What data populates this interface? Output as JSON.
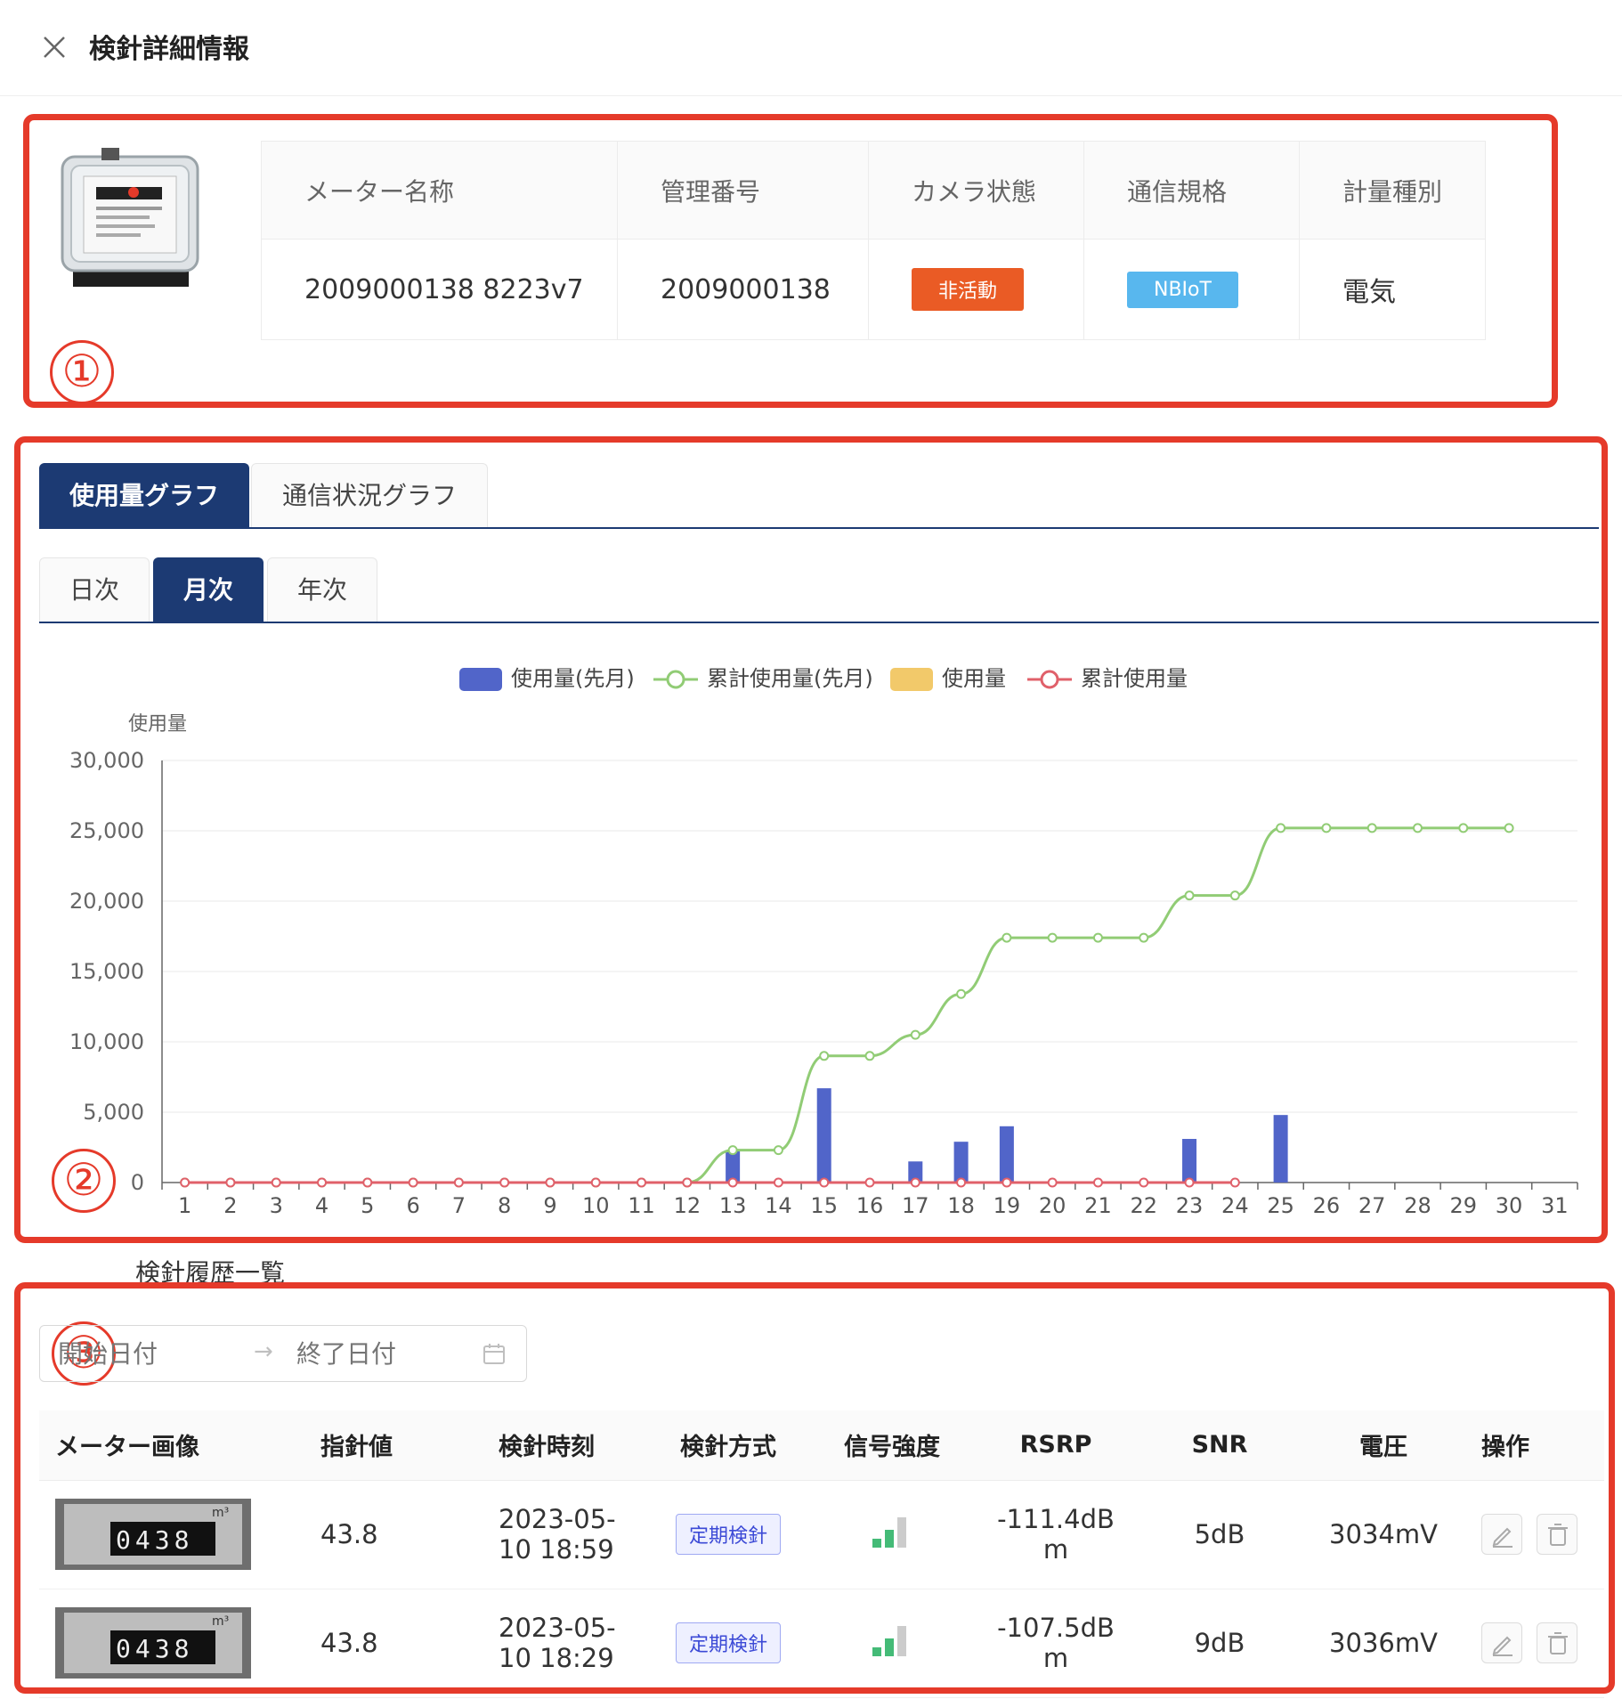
{
  "header": {
    "title": "検針詳細情報"
  },
  "meter_info": {
    "columns": [
      "メーター名称",
      "管理番号",
      "カメラ状態",
      "通信規格",
      "計量種別"
    ],
    "values": {
      "name": "2009000138 8223v7",
      "management_no": "2009000138",
      "camera_status": "非活動",
      "comm_standard": "NBIoT",
      "metering_type": "電気"
    }
  },
  "annotations": [
    "①",
    "②",
    "③"
  ],
  "graph_tabs": [
    "使用量グラフ",
    "通信状況グラフ"
  ],
  "period_tabs": [
    "日次",
    "月次",
    "年次"
  ],
  "colors": {
    "accent": "#1c3a73",
    "bar": "#5165c9",
    "line_prev": "#91cc75",
    "bar_current": "#f2c96a",
    "line_current": "#e0606a",
    "annotation": "#e53a2a"
  },
  "chart_data": {
    "type": "bar",
    "legend": [
      "使用量(先月)",
      "累計使用量(先月)",
      "使用量",
      "累計使用量"
    ],
    "ylabel": "使用量",
    "ylim": [
      0,
      30000
    ],
    "yticks": [
      "0",
      "5,000",
      "10,000",
      "15,000",
      "20,000",
      "25,000",
      "30,000"
    ],
    "categories": [
      "1",
      "2",
      "3",
      "4",
      "5",
      "6",
      "7",
      "8",
      "9",
      "10",
      "11",
      "12",
      "13",
      "14",
      "15",
      "16",
      "17",
      "18",
      "19",
      "20",
      "21",
      "22",
      "23",
      "24",
      "25",
      "26",
      "27",
      "28",
      "29",
      "30",
      "31"
    ],
    "series": [
      {
        "name": "使用量(先月)",
        "type": "bar",
        "values": [
          0,
          0,
          0,
          0,
          0,
          0,
          0,
          0,
          0,
          0,
          0,
          0,
          2300,
          0,
          6700,
          0,
          1500,
          2900,
          4000,
          0,
          0,
          0,
          3100,
          0,
          4800,
          0,
          0,
          0,
          0,
          0,
          0
        ]
      },
      {
        "name": "累計使用量(先月)",
        "type": "line",
        "values": [
          0,
          0,
          0,
          0,
          0,
          0,
          0,
          0,
          0,
          0,
          0,
          0,
          2300,
          2300,
          9000,
          9000,
          10500,
          13400,
          17400,
          17400,
          17400,
          17400,
          20400,
          20400,
          25200,
          25200,
          25200,
          25200,
          25200,
          25200,
          null
        ]
      },
      {
        "name": "使用量",
        "type": "bar",
        "values": []
      },
      {
        "name": "累計使用量",
        "type": "line",
        "values": [
          0,
          0,
          0,
          0,
          0,
          0,
          0,
          0,
          0,
          0,
          0,
          0,
          0,
          0,
          0,
          0,
          0,
          0,
          0,
          0,
          0,
          0,
          0,
          0,
          null,
          null,
          null,
          null,
          null,
          null,
          null
        ]
      }
    ]
  },
  "history": {
    "title": "検針履歴一覧",
    "date_start_placeholder": "開始日付",
    "date_end_placeholder": "終了日付",
    "date_separator": "→",
    "columns": [
      "メーター画像",
      "指針値",
      "検針時刻",
      "検針方式",
      "信号強度",
      "RSRP",
      "SNR",
      "電圧",
      "操作"
    ],
    "thumb_digits": "0438",
    "thumb_unit": "m³",
    "rows": [
      {
        "value": "43.8",
        "time_line1": "2023-05-",
        "time_line2": "10 18:59",
        "method": "定期検針",
        "rsrp_line1": "-111.4dB",
        "rsrp_line2": "m",
        "snr": "5dB",
        "voltage": "3034mV",
        "signal_level": 2
      },
      {
        "value": "43.8",
        "time_line1": "2023-05-",
        "time_line2": "10 18:29",
        "method": "定期検針",
        "rsrp_line1": "-107.5dB",
        "rsrp_line2": "m",
        "snr": "9dB",
        "voltage": "3036mV",
        "signal_level": 2
      }
    ]
  }
}
